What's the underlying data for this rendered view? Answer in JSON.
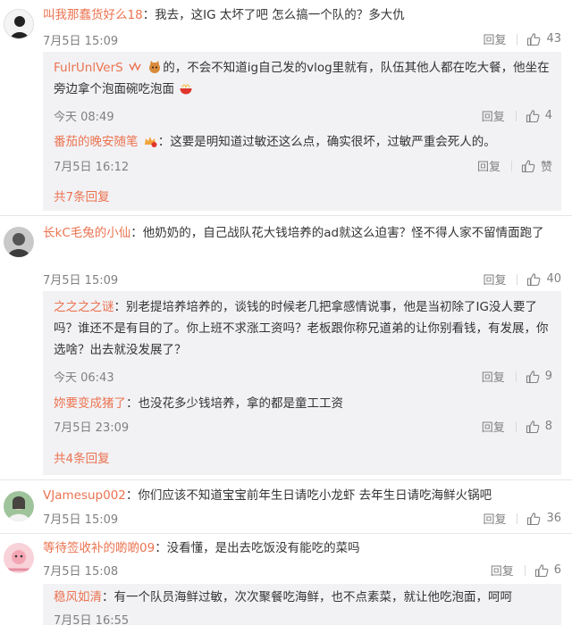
{
  "comments": [
    {
      "user": "叫我那蠢货好么18",
      "text": "：我去，这IG 太坏了吧 怎么搞一个队的？多大仇",
      "date": "7月5日 15:09",
      "reply": "回复",
      "likes": "43",
      "replies": [
        {
          "user": "FulrUnlVerS",
          "text_a": "的，不会不知道ig自己发的vlog里就有，队伍其他人都在吃大餐，他坐在旁边拿个泡面碗吃泡面",
          "date": "今天 08:49",
          "reply": "回复",
          "likes": "4"
        },
        {
          "user": "番茄的晚安随笔",
          "text_a": "：这要是明知道过敏还这么点，确实很坏，过敏严重会死人的。",
          "date": "7月5日 16:12",
          "reply": "回复",
          "likes": "赞"
        }
      ],
      "more": "共7条回复"
    },
    {
      "user": "长kC毛兔的小仙",
      "text": "：他奶奶的，自己战队花大钱培养的ad就这么迫害？怪不得人家不留情面跑了",
      "date": "7月5日 15:09",
      "reply": "回复",
      "likes": "40",
      "replies": [
        {
          "user": "之之之之谜",
          "text_a": "：别老提培养培养的，谈钱的时候老几把拿感情说事，他是当初除了IG没人要了吗？谁还不是有目的了。你上班不求涨工资吗？老板跟你称兄道弟的让你别看钱，有发展，你选啥？出去就没发展了？",
          "date": "今天 06:43",
          "reply": "回复",
          "likes": "9"
        },
        {
          "user": "妳要变成猪了",
          "text_a": "：也没花多少钱培养，拿的都是童工工资",
          "date": "7月5日 23:09",
          "reply": "回复",
          "likes": "8"
        }
      ],
      "more": "共4条回复"
    },
    {
      "user": "VJamesup002",
      "text": "：你们应该不知道宝宝前年生日请吃小龙虾 去年生日请吃海鲜火锅吧",
      "date": "7月5日 15:09",
      "reply": "回复",
      "likes": "36"
    },
    {
      "user": "等待签收补的啲啲09",
      "text": "：没看懂，是出去吃饭没有能吃的菜吗",
      "date": "7月5日 15:08",
      "reply": "回复",
      "likes": "6",
      "replies": [
        {
          "user": "稳风如清",
          "text_a": "：有一个队员海鲜过敏，次次聚餐吃海鲜，也不点素菜，就让他吃泡面，呵呵",
          "date": "7月5日 16:55",
          "reply": "回复",
          "likes": ""
        }
      ]
    }
  ],
  "colors": {
    "accent": "#eb7350",
    "muted": "#808080",
    "subbg": "#f2f2f5"
  }
}
